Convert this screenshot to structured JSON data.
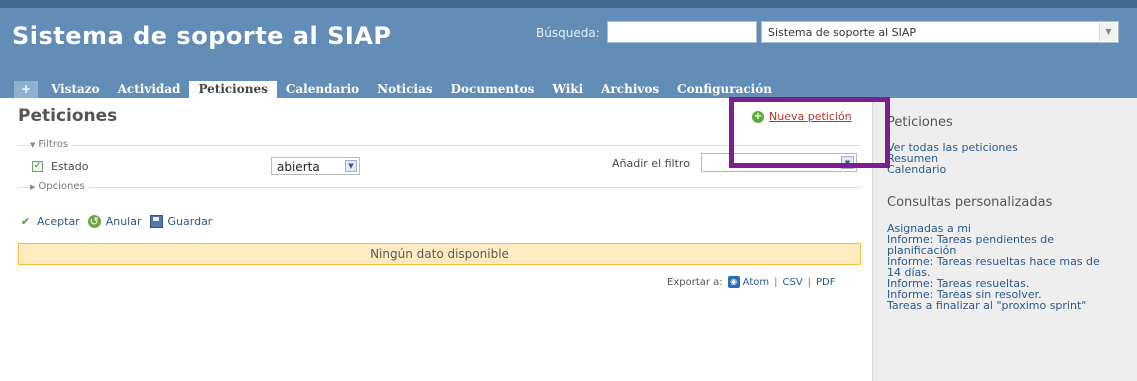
{
  "header": {
    "title": "Sistema de soporte al SIAP",
    "search_label": "Búsqueda:",
    "search_value": "",
    "project_select": "Sistema de soporte al SIAP"
  },
  "tabs": [
    {
      "label": "+"
    },
    {
      "label": "Vistazo"
    },
    {
      "label": "Actividad"
    },
    {
      "label": "Peticiones",
      "selected": true
    },
    {
      "label": "Calendario"
    },
    {
      "label": "Noticias"
    },
    {
      "label": "Documentos"
    },
    {
      "label": "Wiki"
    },
    {
      "label": "Archivos"
    },
    {
      "label": "Configuración"
    }
  ],
  "main": {
    "title": "Peticiones",
    "new_issue": "Nueva petición",
    "filters_legend": "Filtros",
    "filter_estado_label": "Estado",
    "filter_estado_checked": true,
    "filter_estado_value": "abierta",
    "add_filter_label": "Añadir el filtro",
    "add_filter_value": "",
    "options_legend": "Opciones",
    "actions": {
      "apply": "Aceptar",
      "clear": "Anular",
      "save": "Guardar"
    },
    "no_data": "Ningún dato disponible",
    "export": {
      "label": "Exportar a:",
      "atom": "Atom",
      "csv": "CSV",
      "pdf": "PDF",
      "separator": "|"
    }
  },
  "sidebar": {
    "issues_heading": "Peticiones",
    "issues_links": [
      "Ver todas las peticiones",
      "Resumen",
      "Calendario"
    ],
    "queries_heading": "Consultas personalizadas",
    "queries_links": [
      "Asignadas a mi",
      "Informe: Tareas pendientes de",
      "planificación",
      "Informe: Tareas resueltas hace mas de",
      "14 días.",
      "Informe: Tareas resueltas.",
      "Informe: Tareas sin resolver.",
      "Tareas a finalizar al \"proximo sprint\""
    ]
  },
  "colors": {
    "header": "#628db6",
    "highlight": "#7d1e8e",
    "nodata_bg": "#ffebc1",
    "nodata_border": "#fdbd3b",
    "link": "#2a5a8a",
    "new_issue_link": "#b5312b"
  },
  "icons": {
    "new_issue": "add-circle-icon",
    "apply": "checkmark-icon",
    "clear": "undo-icon",
    "save": "save-disk-icon",
    "atom": "rss-feed-icon"
  }
}
